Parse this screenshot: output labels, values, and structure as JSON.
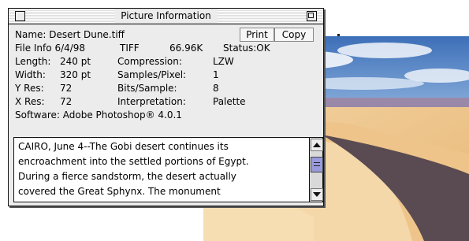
{
  "window": {
    "title": "Picture Information",
    "print_label": "Print",
    "copy_label": "Copy"
  },
  "info": {
    "name": "Name: Desert Dune.tiff",
    "file_info_label": "File Info",
    "file_date": "6/4/98",
    "file_type": "TIFF",
    "file_size": "66.96K",
    "status": "Status:OK",
    "length_label": "Length:",
    "length_value": "240 pt",
    "compression_label": "Compression:",
    "compression_value": "LZW",
    "width_label": "Width:",
    "width_value": "320 pt",
    "samples_label": "Samples/Pixel:",
    "samples_value": "1",
    "yres_label": "Y Res:",
    "yres_value": "72",
    "bits_label": "Bits/Sample:",
    "bits_value": "8",
    "xres_label": "X Res:",
    "xres_value": "72",
    "interp_label": "Interpretation:",
    "interp_value": "Palette",
    "software": "Software: Adobe Photoshop® 4.0.1"
  },
  "description": {
    "lines": [
      "CAIRO, June 4--The Gobi desert continues its",
      "encroachment into the settled portions of Egypt.",
      "During a fierce sandstorm, the desert actually",
      "covered the Great Sphynx. The monument"
    ],
    "scroll_position": 0.25
  },
  "icons": {
    "close": "close-box-icon",
    "zoom": "zoom-box-icon",
    "up": "scroll-up-arrow-icon",
    "down": "scroll-down-arrow-icon"
  }
}
